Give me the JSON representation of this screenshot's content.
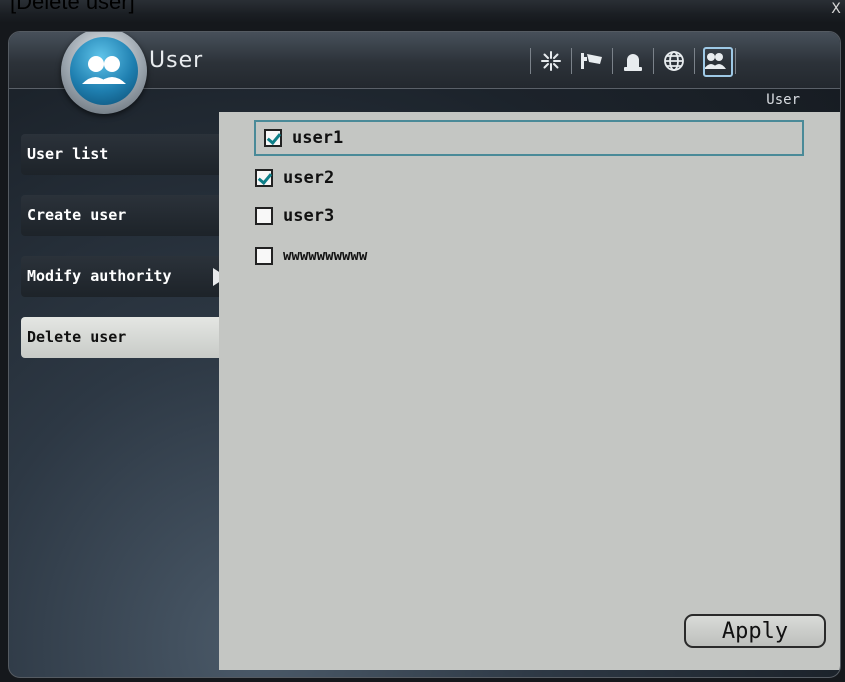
{
  "caption": "[Delete user]",
  "window": {
    "close_label": "X"
  },
  "header": {
    "title": "User",
    "subtitle": "User"
  },
  "toolbar": {
    "icons": [
      "snowflake-icon",
      "camera-icon",
      "alarm-icon",
      "globe-icon",
      "users-icon"
    ],
    "active": "users-icon"
  },
  "sidebar": {
    "items": [
      {
        "label": "User list"
      },
      {
        "label": "Create user"
      },
      {
        "label": "Modify authority"
      },
      {
        "label": "Delete user",
        "selected": true
      }
    ]
  },
  "users": [
    {
      "name": "user1",
      "checked": true
    },
    {
      "name": "user2",
      "checked": true
    },
    {
      "name": "user3",
      "checked": false
    },
    {
      "name": "wwwwwwwwww",
      "checked": false
    }
  ],
  "actions": {
    "apply_label": "Apply"
  },
  "colors": {
    "accent": "#4a8a98",
    "badge": "#1f7fb0",
    "panel": "#c4c6c3"
  }
}
